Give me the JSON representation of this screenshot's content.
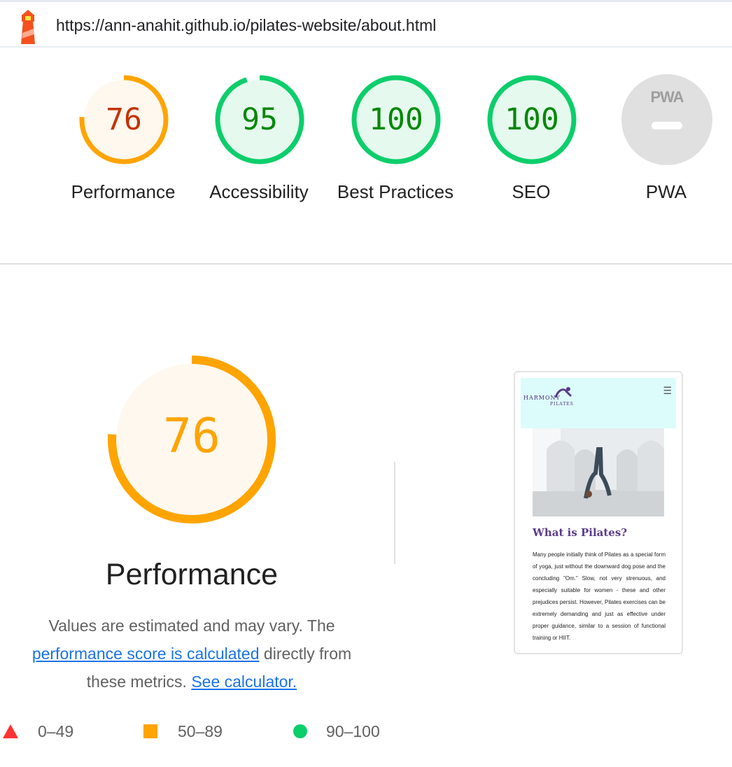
{
  "url": "https://ann-anahit.github.io/pilates-website/about.html",
  "colors": {
    "fail": "#ff3333",
    "average": "#ffa400",
    "average_text": "#c33300",
    "pass": "#0cce6b",
    "pass_text": "#008800",
    "link": "#1a73e8"
  },
  "categories": [
    {
      "label": "Performance",
      "score": "76",
      "value": 0.76
    },
    {
      "label": "Accessibility",
      "score": "95",
      "value": 0.95
    },
    {
      "label": "Best Practices",
      "score": "100",
      "value": 1.0
    },
    {
      "label": "SEO",
      "score": "100",
      "value": 1.0
    },
    {
      "label": "PWA",
      "badge": "PWA"
    }
  ],
  "main": {
    "score": "76",
    "value": 0.76,
    "title": "Performance",
    "desc_text_1": "Values are estimated and may vary. The",
    "desc_link_1": "performance score is calculated",
    "desc_text_2": "directly from these metrics.",
    "desc_link_2": "See calculator."
  },
  "legend": [
    {
      "range": "0–49",
      "icon": "triangle-icon"
    },
    {
      "range": "50–89",
      "icon": "square-icon"
    },
    {
      "range": "90–100",
      "icon": "circle-icon"
    }
  ],
  "screenshot": {
    "brand_top": "HARMONY",
    "brand_bottom": "PILATES",
    "menu_glyph": "☰",
    "heading": "What is Pilates?",
    "paragraph": "Many people initially think of Pilates as a special form of yoga, just without the downward dog pose and the concluding \"Om.\" Slow, not very strenuous, and especially suitable for women - these and other prejudices persist. However, Pilates exercises can be extremely demanding and just as effective under proper guidance, similar to a session of functional training or HIIT."
  }
}
